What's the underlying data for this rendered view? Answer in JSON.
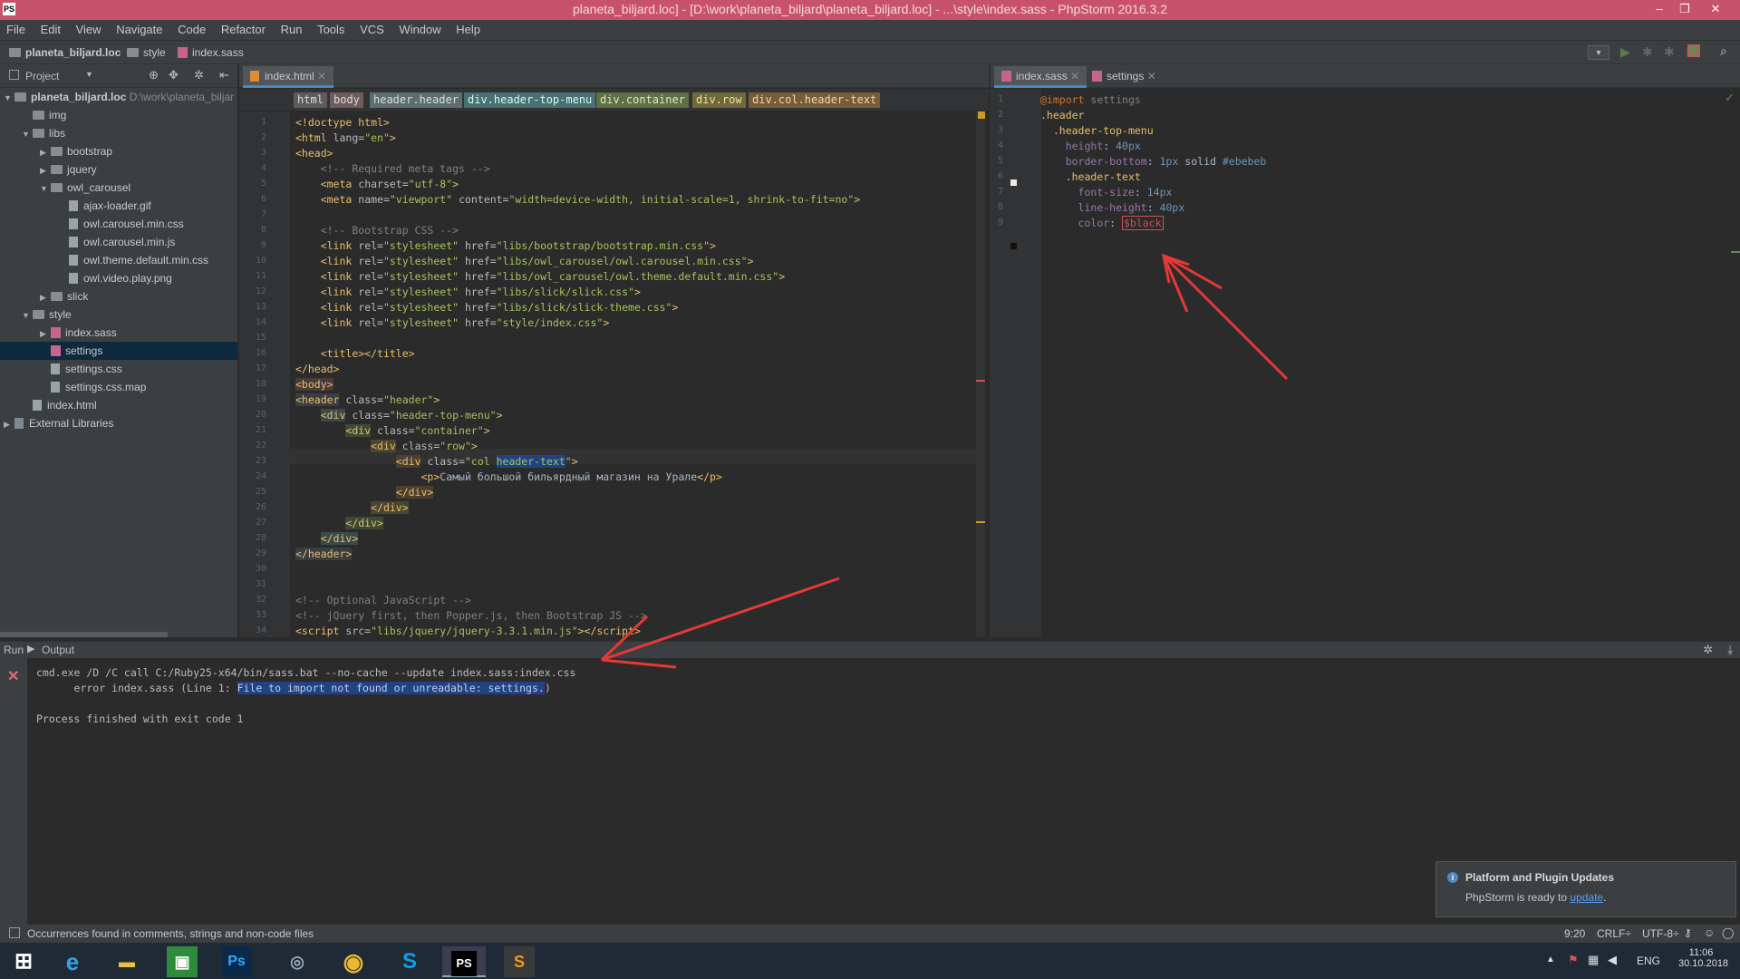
{
  "window": {
    "title": "planeta_biljard.loc] - [D:\\work\\planeta_biljard\\planeta_biljard.loc] - ...\\style\\index.sass - PhpStorm 2016.3.2",
    "logo": "PS"
  },
  "menu": [
    "File",
    "Edit",
    "View",
    "Navigate",
    "Code",
    "Refactor",
    "Run",
    "Tools",
    "VCS",
    "Window",
    "Help"
  ],
  "breadcrumb": [
    "planeta_biljard.loc",
    "style",
    "index.sass"
  ],
  "project": {
    "header": "Project",
    "root": "planeta_biljard.loc",
    "root_path": "D:\\work\\planeta_biljar",
    "items": [
      {
        "label": "img",
        "depth": 1,
        "type": "folder",
        "arrow": ""
      },
      {
        "label": "libs",
        "depth": 1,
        "type": "folder",
        "arrow": "▼"
      },
      {
        "label": "bootstrap",
        "depth": 2,
        "type": "folder",
        "arrow": "▶"
      },
      {
        "label": "jquery",
        "depth": 2,
        "type": "folder",
        "arrow": "▶"
      },
      {
        "label": "owl_carousel",
        "depth": 2,
        "type": "folder",
        "arrow": "▼"
      },
      {
        "label": "ajax-loader.gif",
        "depth": 3,
        "type": "file",
        "arrow": ""
      },
      {
        "label": "owl.carousel.min.css",
        "depth": 3,
        "type": "file",
        "arrow": ""
      },
      {
        "label": "owl.carousel.min.js",
        "depth": 3,
        "type": "file",
        "arrow": ""
      },
      {
        "label": "owl.theme.default.min.css",
        "depth": 3,
        "type": "file",
        "arrow": ""
      },
      {
        "label": "owl.video.play.png",
        "depth": 3,
        "type": "file",
        "arrow": ""
      },
      {
        "label": "slick",
        "depth": 2,
        "type": "folder",
        "arrow": "▶"
      },
      {
        "label": "style",
        "depth": 1,
        "type": "folder",
        "arrow": "▼"
      },
      {
        "label": "index.sass",
        "depth": 2,
        "type": "sass",
        "arrow": "▶"
      },
      {
        "label": "settings",
        "depth": 2,
        "type": "sass",
        "arrow": "",
        "selected": true
      },
      {
        "label": "settings.css",
        "depth": 2,
        "type": "file",
        "arrow": ""
      },
      {
        "label": "settings.css.map",
        "depth": 2,
        "type": "file",
        "arrow": ""
      },
      {
        "label": "index.html",
        "depth": 1,
        "type": "file",
        "arrow": ""
      },
      {
        "label": "External Libraries",
        "depth": 0,
        "type": "lib",
        "arrow": "▶"
      }
    ]
  },
  "left_editor": {
    "tab": "index.html",
    "tags": [
      "html",
      "body",
      "header.header",
      "div.header-top-menu",
      "div.container",
      "div.row",
      "div.col.header-text"
    ],
    "line_numbers": [
      "1",
      "2",
      "3",
      "4",
      "5",
      "6",
      "7",
      "8",
      "9",
      "10",
      "11",
      "12",
      "13",
      "14",
      "15",
      "16",
      "17",
      "18",
      "19",
      "20",
      "21",
      "22",
      "23",
      "24",
      "25",
      "26",
      "27",
      "28",
      "29",
      "30",
      "31",
      "32",
      "33",
      "34"
    ]
  },
  "right_editor": {
    "tabs": [
      "index.sass",
      "settings"
    ],
    "line_numbers": [
      "1",
      "2",
      "3",
      "4",
      "5",
      "6",
      "7",
      "8",
      "9"
    ]
  },
  "run": {
    "title": "Run",
    "subtitle": "Output",
    "lines": [
      "cmd.exe /D /C call C:/Ruby25-x64/bin/sass.bat --no-cache --update index.sass:index.css",
      "      error index.sass (Line 1: ",
      "File to import not found or unreadable: settings.",
      ")",
      "Process finished with exit code 1"
    ]
  },
  "status": {
    "left": "Occurrences found in comments, strings and non-code files",
    "pos": "9:20",
    "eol": "CRLF÷",
    "enc": "UTF-8÷"
  },
  "popup": {
    "title": "Platform and Plugin Updates",
    "text": "PhpStorm is ready to ",
    "link": "update",
    "end": "."
  },
  "taskbar": {
    "lang": "ENG",
    "time": "11:06",
    "date": "30.10.2018"
  },
  "colors": {
    "accent": "#4a88c7",
    "title": "#c8526a",
    "error": "#e53935"
  }
}
